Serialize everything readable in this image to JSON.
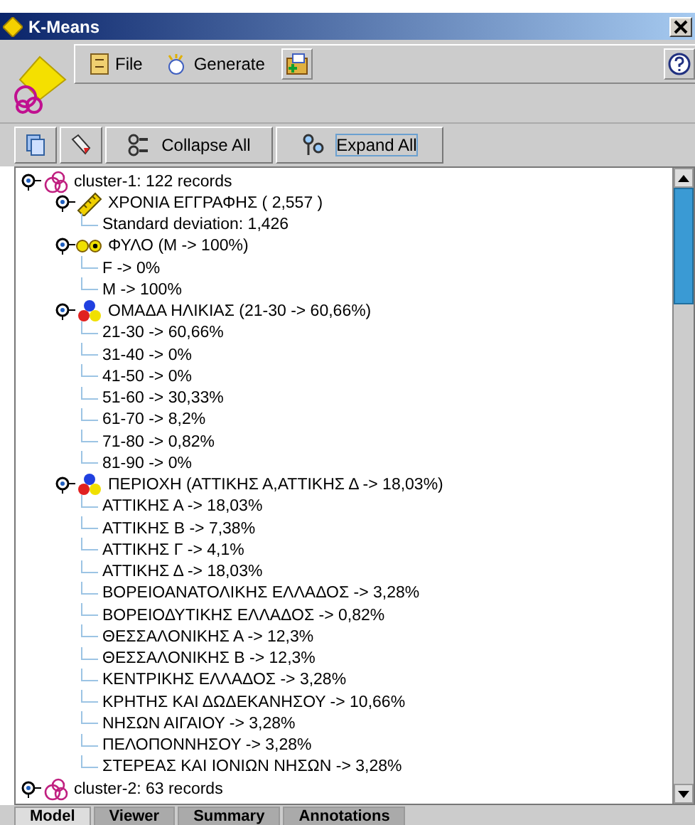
{
  "window": {
    "title": "K-Means"
  },
  "menu": [
    {
      "label": "File",
      "kind": "file"
    },
    {
      "label": "Generate",
      "kind": "generate"
    }
  ],
  "toolbar": [
    {
      "label": "Collapse All",
      "kind": "collapse"
    },
    {
      "label": "Expand All",
      "kind": "expand"
    }
  ],
  "tree": [
    {
      "label": "cluster-1: 122 records",
      "kind": "cluster",
      "children": [
        {
          "label": "ΧΡΟΝΙΑ ΕΓΓΡΑΦΗΣ ( 2,557 )",
          "kind": "range",
          "children": [
            {
              "label": "Standard deviation: 1,426"
            }
          ]
        },
        {
          "label": "ΦΥΛΟ (M -> 100%)",
          "kind": "flag",
          "children": [
            {
              "label": "F -> 0%"
            },
            {
              "label": "M -> 100%"
            }
          ]
        },
        {
          "label": "ΟΜΑΔΑ ΗΛΙΚΙΑΣ (21-30 -> 60,66%)",
          "kind": "set",
          "children": [
            {
              "label": "21-30 -> 60,66%"
            },
            {
              "label": "31-40 -> 0%"
            },
            {
              "label": "41-50 -> 0%"
            },
            {
              "label": "51-60 -> 30,33%"
            },
            {
              "label": "61-70 -> 8,2%"
            },
            {
              "label": "71-80 -> 0,82%"
            },
            {
              "label": "81-90 -> 0%"
            }
          ]
        },
        {
          "label": "ΠΕΡΙΟΧΗ (ΑΤΤΙΚΗΣ Α,ΑΤΤΙΚΗΣ Δ -> 18,03%)",
          "kind": "set",
          "children": [
            {
              "label": "ΑΤΤΙΚΗΣ Α -> 18,03%"
            },
            {
              "label": "ΑΤΤΙΚΗΣ Β -> 7,38%"
            },
            {
              "label": "ΑΤΤΙΚΗΣ Γ -> 4,1%"
            },
            {
              "label": "ΑΤΤΙΚΗΣ Δ -> 18,03%"
            },
            {
              "label": "ΒΟΡΕΙΟΑΝΑΤΟΛΙΚΗΣ ΕΛΛΑΔΟΣ -> 3,28%"
            },
            {
              "label": "ΒΟΡΕΙΟΔΥΤΙΚΗΣ ΕΛΛΑΔΟΣ -> 0,82%"
            },
            {
              "label": "ΘΕΣΣΑΛΟΝΙΚΗΣ Α -> 12,3%"
            },
            {
              "label": "ΘΕΣΣΑΛΟΝΙΚΗΣ Β -> 12,3%"
            },
            {
              "label": "ΚΕΝΤΡΙΚΗΣ ΕΛΛΑΔΟΣ -> 3,28%"
            },
            {
              "label": "ΚΡΗΤΗΣ ΚΑΙ ΔΩΔΕΚΑΝΗΣΟΥ -> 10,66%"
            },
            {
              "label": "ΝΗΣΩΝ ΑΙΓΑΙΟΥ -> 3,28%"
            },
            {
              "label": "ΠΕΛΟΠΟΝΝΗΣΟΥ -> 3,28%"
            },
            {
              "label": "ΣΤΕΡΕΑΣ ΚΑΙ ΙΟΝΙΩΝ ΝΗΣΩΝ -> 3,28%"
            }
          ]
        }
      ]
    },
    {
      "label": "cluster-2: 63 records",
      "kind": "cluster"
    }
  ],
  "tabs": [
    {
      "label": "Model",
      "selected": true
    },
    {
      "label": "Viewer",
      "selected": false
    },
    {
      "label": "Summary",
      "selected": false
    },
    {
      "label": "Annotations",
      "selected": false
    }
  ]
}
